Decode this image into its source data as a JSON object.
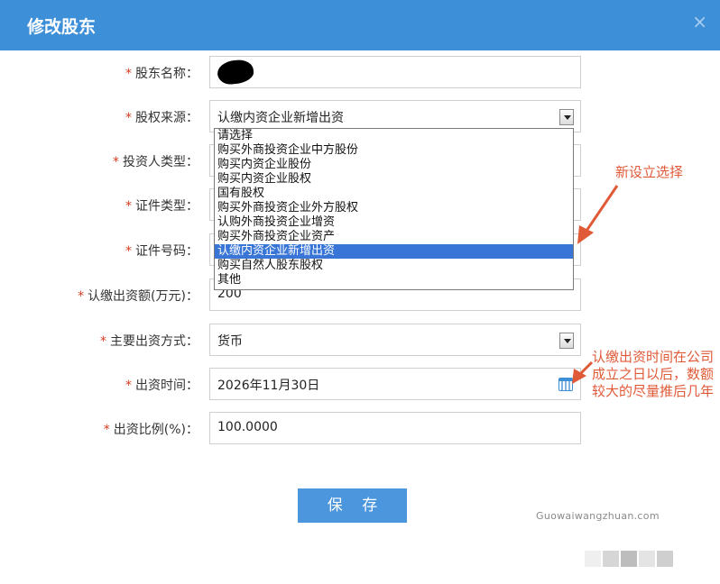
{
  "dialog": {
    "title": "修改股东",
    "close_icon": "×"
  },
  "form": {
    "shareholder_name": {
      "label": "股东名称：",
      "value": ""
    },
    "equity_source": {
      "label": "股权来源：",
      "value": "认缴内资企业新增出资"
    },
    "investor_type": {
      "label": "投资人类型："
    },
    "id_type": {
      "label": "证件类型："
    },
    "id_number": {
      "label": "证件号码："
    },
    "subscribed_capital": {
      "label": "认缴出资额(万元)：",
      "value": "200"
    },
    "contribution_method": {
      "label": "主要出资方式：",
      "value": "货币"
    },
    "contribution_date": {
      "label": "出资时间：",
      "value": "2026年11月30日"
    },
    "contribution_ratio": {
      "label": "出资比例(%)：",
      "value": "100.0000"
    },
    "required_mark": "*"
  },
  "dropdown": {
    "options": [
      "请选择",
      "购买外商投资企业中方股份",
      "购买内资企业股份",
      "购买内资企业股权",
      "国有股权",
      "购买外商投资企业外方股权",
      "认购外商投资企业增资",
      "购买外商投资企业资产",
      "认缴内资企业新增出资",
      "购买自然人股东股权",
      "其他"
    ],
    "selected_index": 8
  },
  "buttons": {
    "save_label": "保 存"
  },
  "annotations": {
    "note1": "新设立选择",
    "note2": "认缴出资时间在公司成立之日以后，数额较大的尽量推后几年",
    "color": "#e05a38"
  },
  "watermark": "Guowaiwangzhuan.com",
  "colors": {
    "header": "#3d8fd8",
    "button": "#4b96dc",
    "selection": "#3875d7",
    "required": "#d83a1f"
  }
}
